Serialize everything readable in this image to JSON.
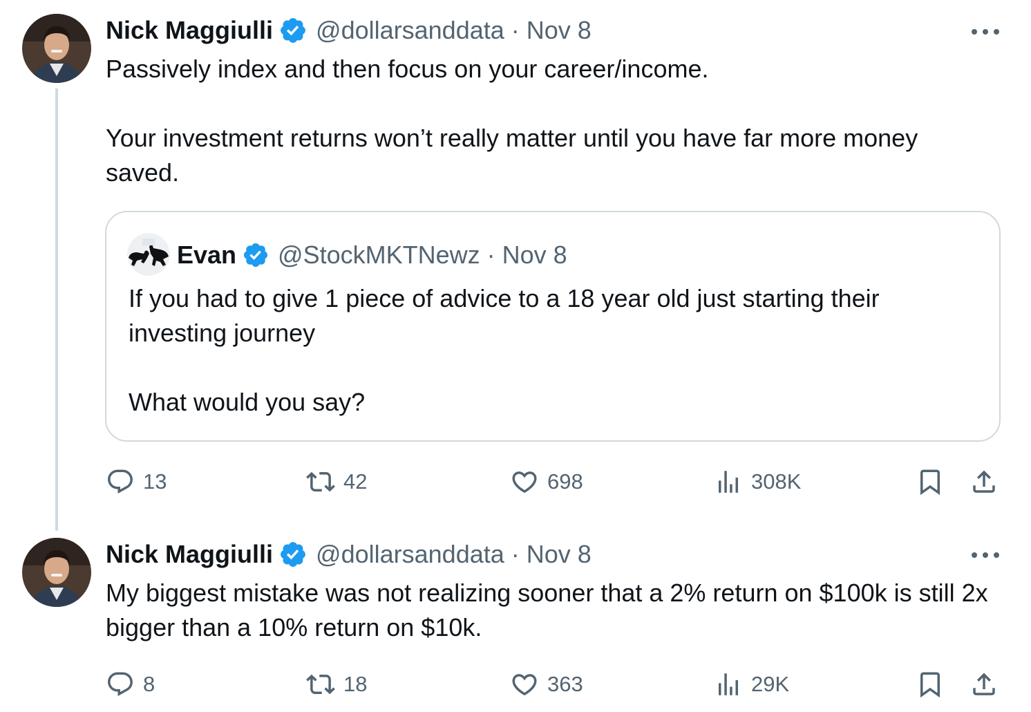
{
  "tweets": [
    {
      "author": {
        "name": "Nick Maggiulli",
        "handle": "@dollarsanddata"
      },
      "separator": "·",
      "date": "Nov 8",
      "text": [
        "Passively index and then focus on your career/income.",
        "Your investment returns won’t really matter until you have far more money saved."
      ],
      "quote": {
        "author": {
          "name": "Evan",
          "handle": "@StockMKTNewz"
        },
        "separator": "·",
        "date": "Nov 8",
        "text": [
          "If you had to give 1 piece of advice to a 18 year old just starting their investing journey",
          "What would you say?"
        ]
      },
      "stats": {
        "replies": "13",
        "retweets": "42",
        "likes": "698",
        "views": "308K"
      }
    },
    {
      "author": {
        "name": "Nick Maggiulli",
        "handle": "@dollarsanddata"
      },
      "separator": "·",
      "date": "Nov 8",
      "text": [
        "My biggest mistake was not realizing sooner that a 2% return on $100k is still 2x bigger than a 10% return on $10k."
      ],
      "stats": {
        "replies": "8",
        "retweets": "18",
        "likes": "363",
        "views": "29K"
      }
    }
  ],
  "icons": {
    "reply": "reply-icon",
    "retweet": "retweet-icon",
    "like": "heart-icon",
    "views": "views-icon",
    "bookmark": "bookmark-icon",
    "share": "share-icon",
    "more": "more-icon",
    "verified": "verified-badge-icon"
  },
  "colors": {
    "text_primary": "#0f1419",
    "text_secondary": "#536471",
    "verified_blue": "#1d9bf0",
    "border": "#cfd9de"
  }
}
